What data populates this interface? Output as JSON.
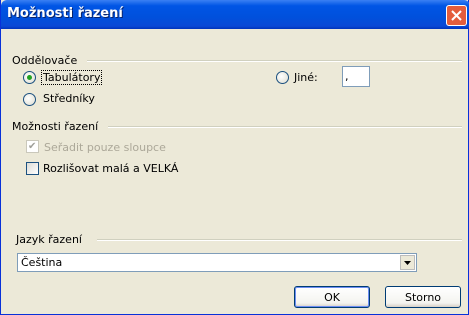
{
  "window": {
    "title": "Možnosti řazení"
  },
  "separators": {
    "group_label": "Oddělovače",
    "tabs_label": "Tabulátory",
    "semicolons_label": "Středníky",
    "other_label": "Jiné:",
    "other_value": ",",
    "selected": "tabs"
  },
  "sort_options": {
    "group_label": "Možnosti řazení",
    "columns_only_label": "Seřadit pouze sloupce",
    "columns_only_checked": true,
    "columns_only_enabled": false,
    "case_sensitive_label": "Rozlišovat malá a VELKÁ",
    "case_sensitive_checked": false
  },
  "language": {
    "group_label": "Jazyk řazení",
    "selected": "Čeština"
  },
  "buttons": {
    "ok": "OK",
    "cancel": "Storno"
  },
  "colors": {
    "title_bar": "#0055e5",
    "close_button": "#e45d3c",
    "dialog_bg": "#ece9d8"
  }
}
